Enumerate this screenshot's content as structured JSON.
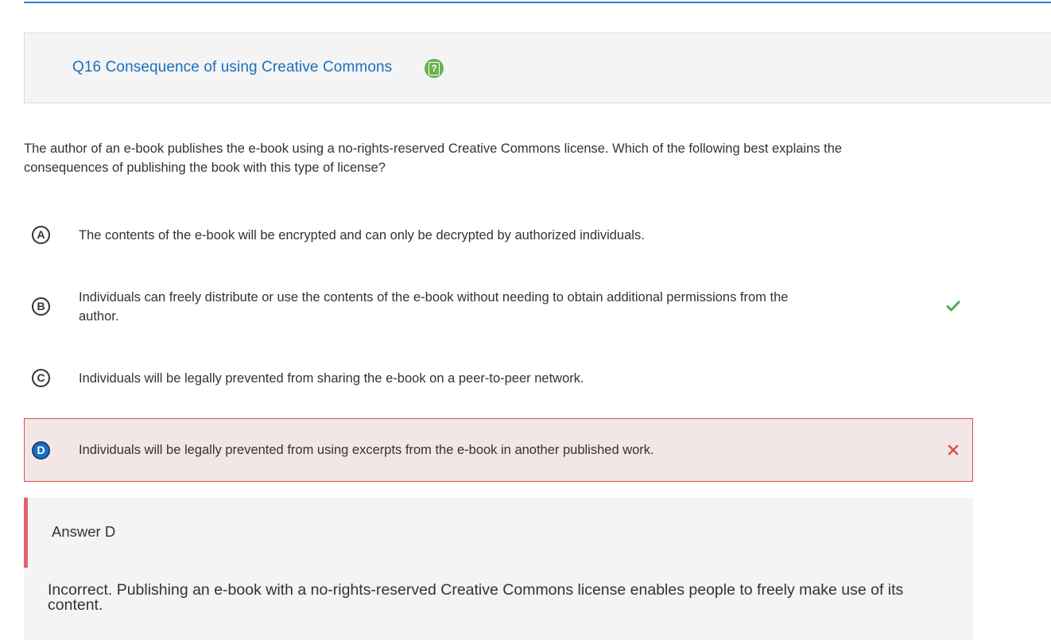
{
  "question": {
    "title": "Q16 Consequence of using Creative Commons",
    "help_icon": "help-question-icon",
    "text": "The author of an e-book publishes the e-book using a no-rights-reserved Creative Commons license. Which of the following best explains the consequences of publishing the book with this type of license?"
  },
  "options": [
    {
      "letter": "A",
      "text": "The contents of the e-book will be encrypted and can only be decrypted by authorized individuals.",
      "selected": false,
      "mark": null
    },
    {
      "letter": "B",
      "text": "Individuals can freely distribute or use the contents of the e-book without needing to obtain additional permissions from the author.",
      "selected": false,
      "mark": "checkmark-icon"
    },
    {
      "letter": "C",
      "text": "Individuals will be legally prevented from sharing the e-book on a peer-to-peer network.",
      "selected": false,
      "mark": null
    },
    {
      "letter": "D",
      "text": "Individuals will be legally prevented from using excerpts from the e-book in another published work.",
      "selected": true,
      "mark": "cross-icon"
    }
  ],
  "feedback": {
    "answer_label": "Answer D",
    "explanation": "Incorrect. Publishing an e-book with a no-rights-reserved Creative Commons license enables people to freely make use of its content."
  },
  "colors": {
    "accent": "#1a6fbf",
    "correct": "#4caf50",
    "incorrect": "#d9534f",
    "selected_bg": "#f3e6e6",
    "help_green": "#6ab04c",
    "feedback_bar": "#e06470"
  }
}
